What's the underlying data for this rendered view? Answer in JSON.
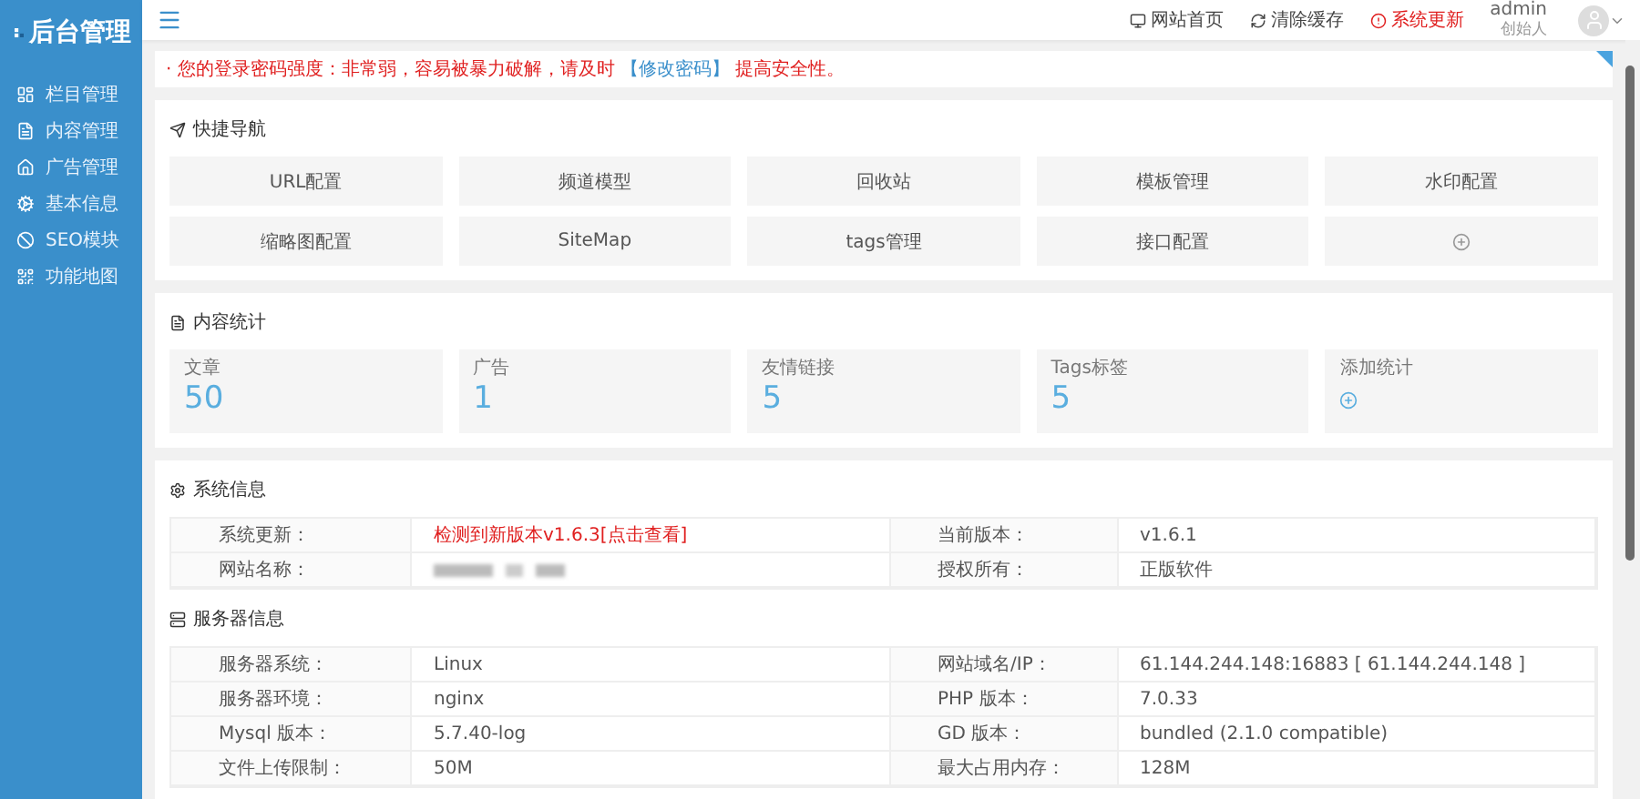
{
  "sidebar": {
    "logo": "后台管理",
    "items": [
      {
        "label": "栏目管理"
      },
      {
        "label": "内容管理"
      },
      {
        "label": "广告管理"
      },
      {
        "label": "基本信息"
      },
      {
        "label": "SEO模块"
      },
      {
        "label": "功能地图"
      }
    ]
  },
  "header": {
    "links": [
      {
        "label": "网站首页",
        "kind": "home"
      },
      {
        "label": "清除缓存",
        "kind": "refresh"
      },
      {
        "label": "系统更新",
        "kind": "alert"
      }
    ],
    "user": {
      "name": "admin",
      "role": "创始人"
    }
  },
  "alert": {
    "prefix": "· 您的登录密码强度：非常弱，容易被暴力破解，请及时",
    "link": "【修改密码】",
    "suffix": "提高安全性。"
  },
  "quick_nav": {
    "title": "快捷导航",
    "items": [
      {
        "kind": "text",
        "label": "URL配置"
      },
      {
        "kind": "text",
        "label": "频道模型"
      },
      {
        "kind": "text",
        "label": "回收站"
      },
      {
        "kind": "text",
        "label": "模板管理"
      },
      {
        "kind": "text",
        "label": "水印配置"
      },
      {
        "kind": "text",
        "label": "缩略图配置"
      },
      {
        "kind": "text",
        "label": "SiteMap"
      },
      {
        "kind": "text",
        "label": "tags管理"
      },
      {
        "kind": "text",
        "label": "接口配置"
      },
      {
        "kind": "add"
      }
    ]
  },
  "stats": {
    "title": "内容统计",
    "items": [
      {
        "kind": "number",
        "label": "文章",
        "value": "50"
      },
      {
        "kind": "number",
        "label": "广告",
        "value": "1"
      },
      {
        "kind": "number",
        "label": "友情链接",
        "value": "5"
      },
      {
        "kind": "number",
        "label": "Tags标签",
        "value": "5"
      },
      {
        "kind": "add",
        "label": "添加统计"
      }
    ]
  },
  "system_info": {
    "title": "系统信息",
    "rows": [
      [
        {
          "kind": "label",
          "text": "系统更新："
        },
        {
          "kind": "alert",
          "text": "检测到新版本v1.6.3[点击查看]"
        },
        {
          "kind": "label",
          "text": "当前版本："
        },
        {
          "kind": "text",
          "text": "v1.6.1"
        }
      ],
      [
        {
          "kind": "label",
          "text": "网站名称："
        },
        {
          "kind": "redacted"
        },
        {
          "kind": "label",
          "text": "授权所有："
        },
        {
          "kind": "text",
          "text": "正版软件"
        }
      ]
    ]
  },
  "server_info": {
    "title": "服务器信息",
    "rows": [
      [
        {
          "kind": "label",
          "text": "服务器系统："
        },
        {
          "kind": "text",
          "text": "Linux"
        },
        {
          "kind": "label",
          "text": "网站域名/IP："
        },
        {
          "kind": "text",
          "text": "61.144.244.148:16883 [ 61.144.244.148 ]"
        }
      ],
      [
        {
          "kind": "label",
          "text": "服务器环境："
        },
        {
          "kind": "text",
          "text": "nginx"
        },
        {
          "kind": "label",
          "text": "PHP 版本："
        },
        {
          "kind": "text",
          "text": "7.0.33"
        }
      ],
      [
        {
          "kind": "label",
          "text": "Mysql 版本："
        },
        {
          "kind": "text",
          "text": "5.7.40-log"
        },
        {
          "kind": "label",
          "text": "GD 版本："
        },
        {
          "kind": "text",
          "text": "bundled (2.1.0 compatible)"
        }
      ],
      [
        {
          "kind": "label",
          "text": "文件上传限制："
        },
        {
          "kind": "text",
          "text": "50M"
        },
        {
          "kind": "label",
          "text": "最大占用内存："
        },
        {
          "kind": "text",
          "text": "128M"
        }
      ]
    ]
  }
}
